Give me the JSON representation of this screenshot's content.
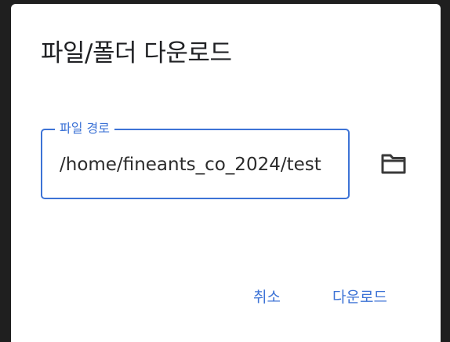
{
  "dialog": {
    "title": "파일/폴더 다운로드",
    "path_field": {
      "label": "파일 경로",
      "value": "/home/fineants_co_2024/test"
    },
    "folder_icon": "folder-icon",
    "actions": {
      "cancel_label": "취소",
      "download_label": "다운로드"
    }
  },
  "colors": {
    "accent": "#3d73d6",
    "backdrop": "#1f1f1f",
    "surface": "#ffffff",
    "text": "#202124"
  }
}
